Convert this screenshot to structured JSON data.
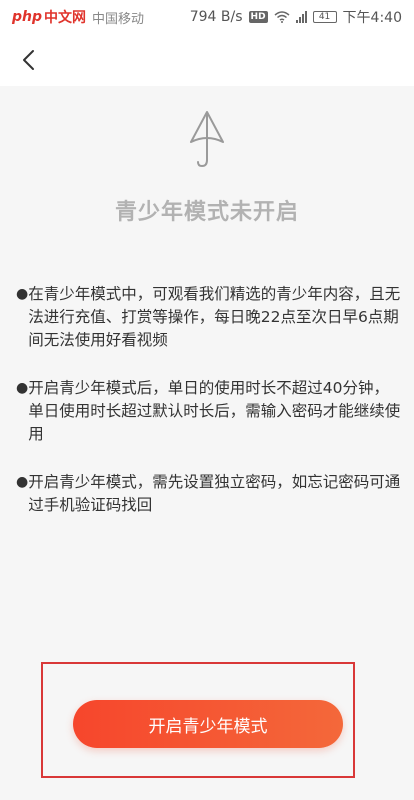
{
  "status_bar": {
    "watermark_php": "php",
    "watermark_cn": "中文网",
    "carrier": "中国移动",
    "net_speed": "794 B/s",
    "hd": "HD",
    "battery": "41",
    "time": "下午4:40"
  },
  "nav": {
    "back_icon": "chevron-left-icon"
  },
  "hero": {
    "icon": "umbrella-icon"
  },
  "title": "青少年模式未开启",
  "rules": [
    {
      "bullet": "●",
      "text": "在青少年模式中，可观看我们精选的青少年内容，且无法进行充值、打赏等操作，每日晚22点至次日早6点期间无法使用好看视频"
    },
    {
      "bullet": "●",
      "text": "开启青少年模式后，单日的使用时长不超过40分钟，单日使用时长超过默认时长后，需输入密码才能继续使用"
    },
    {
      "bullet": "●",
      "text": "开启青少年模式，需先设置独立密码，如忘记密码可通过手机验证码找回"
    }
  ],
  "action": {
    "enable_label": "开启青少年模式"
  },
  "colors": {
    "accent_start": "#f6462c",
    "accent_end": "#f4683a",
    "title_gray": "#b2b2b2",
    "annotation_red": "#d93838"
  }
}
